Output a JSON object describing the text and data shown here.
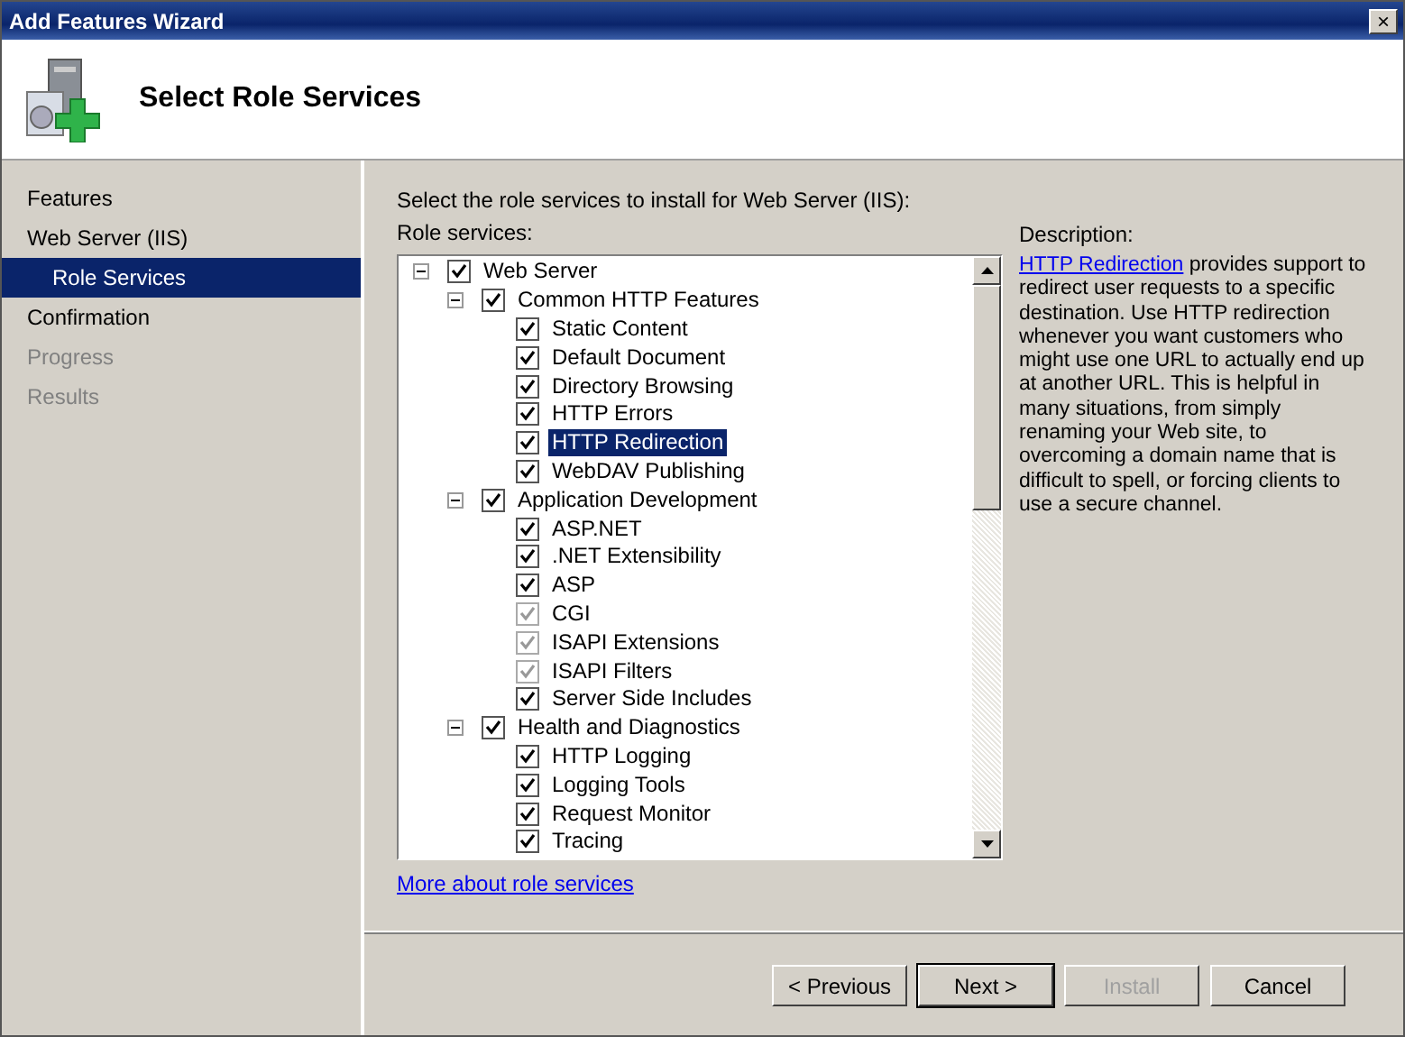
{
  "window": {
    "title": "Add Features Wizard",
    "close": "×"
  },
  "header": {
    "title": "Select Role Services"
  },
  "sidebar": {
    "items": [
      {
        "label": "Features",
        "selected": false,
        "disabled": false
      },
      {
        "label": "Web Server (IIS)",
        "selected": false,
        "disabled": false,
        "children": [
          {
            "label": "Role Services",
            "selected": true,
            "disabled": false
          }
        ]
      },
      {
        "label": "Confirmation",
        "selected": false,
        "disabled": false
      },
      {
        "label": "Progress",
        "selected": false,
        "disabled": true
      },
      {
        "label": "Results",
        "selected": false,
        "disabled": true
      }
    ]
  },
  "instruction": "Select the role services to install for Web Server (IIS):",
  "role_services_label": "Role services:",
  "tree": [
    {
      "label": "Web Server",
      "checked": true,
      "disabled": false,
      "selected": false,
      "expanded": true,
      "children": [
        {
          "label": "Common HTTP Features",
          "checked": true,
          "disabled": false,
          "selected": false,
          "expanded": true,
          "children": [
            {
              "label": "Static Content",
              "checked": true,
              "disabled": false,
              "selected": false
            },
            {
              "label": "Default Document",
              "checked": true,
              "disabled": false,
              "selected": false
            },
            {
              "label": "Directory Browsing",
              "checked": true,
              "disabled": false,
              "selected": false
            },
            {
              "label": "HTTP Errors",
              "checked": true,
              "disabled": false,
              "selected": false
            },
            {
              "label": "HTTP Redirection",
              "checked": true,
              "disabled": false,
              "selected": true
            },
            {
              "label": "WebDAV Publishing",
              "checked": true,
              "disabled": false,
              "selected": false
            }
          ]
        },
        {
          "label": "Application Development",
          "checked": true,
          "disabled": false,
          "selected": false,
          "expanded": true,
          "children": [
            {
              "label": "ASP.NET",
              "checked": true,
              "disabled": false,
              "selected": false
            },
            {
              "label": ".NET Extensibility",
              "checked": true,
              "disabled": false,
              "selected": false
            },
            {
              "label": "ASP",
              "checked": true,
              "disabled": false,
              "selected": false
            },
            {
              "label": "CGI",
              "checked": true,
              "disabled": true,
              "selected": false
            },
            {
              "label": "ISAPI Extensions",
              "checked": true,
              "disabled": true,
              "selected": false
            },
            {
              "label": "ISAPI Filters",
              "checked": true,
              "disabled": true,
              "selected": false
            },
            {
              "label": "Server Side Includes",
              "checked": true,
              "disabled": false,
              "selected": false
            }
          ]
        },
        {
          "label": "Health and Diagnostics",
          "checked": true,
          "disabled": false,
          "selected": false,
          "expanded": true,
          "children": [
            {
              "label": "HTTP Logging",
              "checked": true,
              "disabled": false,
              "selected": false
            },
            {
              "label": "Logging Tools",
              "checked": true,
              "disabled": false,
              "selected": false
            },
            {
              "label": "Request Monitor",
              "checked": true,
              "disabled": false,
              "selected": false
            },
            {
              "label": "Tracing",
              "checked": true,
              "disabled": false,
              "selected": false
            }
          ]
        }
      ]
    }
  ],
  "more_link": "More about role services",
  "description": {
    "label": "Description:",
    "link": "HTTP Redirection",
    "text": " provides support to redirect user requests to a specific destination. Use HTTP redirection whenever you want customers who might use one URL to actually end up at another URL. This is helpful in many situations, from simply renaming your Web site, to overcoming a domain name that is difficult to spell, or forcing clients to use a secure channel."
  },
  "buttons": [
    {
      "label": "< Previous",
      "disabled": false,
      "default": false
    },
    {
      "label": "Next >",
      "disabled": false,
      "default": true
    },
    {
      "label": "Install",
      "disabled": true,
      "default": false
    },
    {
      "label": "Cancel",
      "disabled": false,
      "default": false
    }
  ]
}
